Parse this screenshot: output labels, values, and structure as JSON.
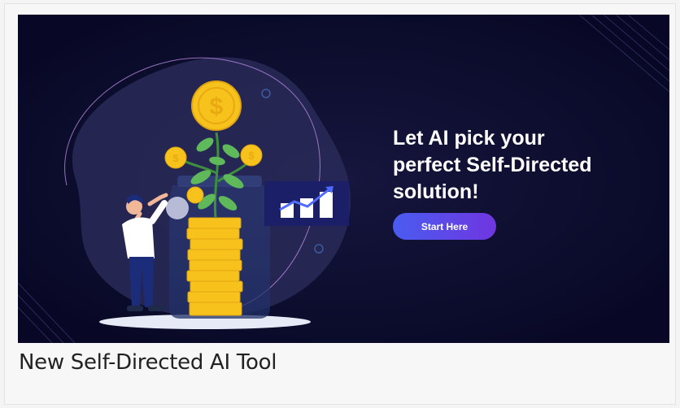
{
  "banner": {
    "headline_lines": [
      "Let AI pick your",
      "perfect Self-Directed",
      "solution!"
    ],
    "cta_label": "Start Here",
    "colors": {
      "background": "#080826",
      "cta_start": "#4a5cf0",
      "cta_end": "#6f36e0",
      "coin": "#f7c21b",
      "text": "#ffffff"
    }
  },
  "card": {
    "title": "New Self-Directed AI Tool"
  },
  "icons": {
    "coin_symbol": "$",
    "illustration": "person-with-money-plant-illustration",
    "chart": "growth-chart-icon"
  }
}
